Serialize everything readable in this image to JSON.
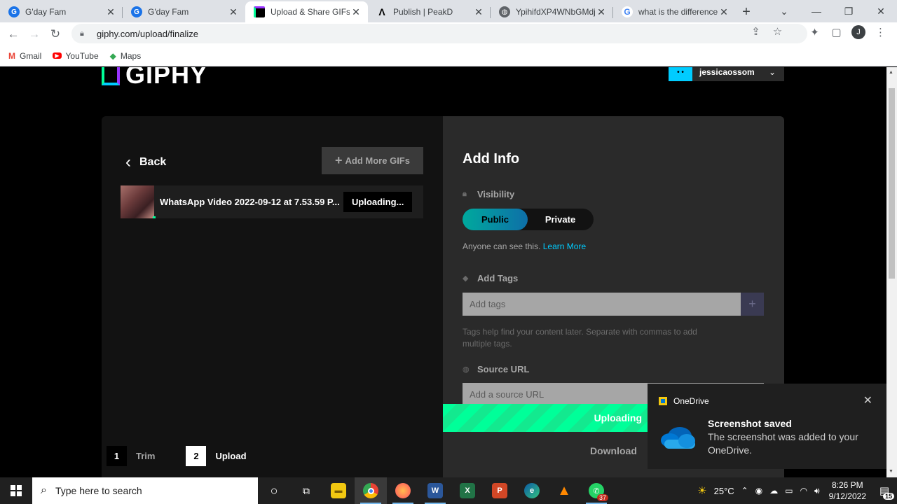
{
  "browser": {
    "tabs": [
      {
        "title": "G'day Fam",
        "favicon": "globe-icon",
        "color": "#1a73e8"
      },
      {
        "title": "G'day Fam",
        "favicon": "globe-icon",
        "color": "#1a73e8"
      },
      {
        "title": "Upload & Share GIFs",
        "favicon": "giphy-icon",
        "color": "#000000"
      },
      {
        "title": "Publish | PeakD",
        "favicon": "peakd-icon",
        "color": "#e31337"
      },
      {
        "title": "YpihifdXP4WNbGMdj",
        "favicon": "globe-icon",
        "color": "#5f6368"
      },
      {
        "title": "what is the difference",
        "favicon": "google-icon",
        "color": "#4285f4"
      }
    ],
    "new_tab_symbol": "+",
    "url": "giphy.com/upload/finalize",
    "profile_initial": "J",
    "bookmarks": [
      {
        "label": "Gmail",
        "icon": "gmail-icon"
      },
      {
        "label": "YouTube",
        "icon": "youtube-icon"
      },
      {
        "label": "Maps",
        "icon": "maps-icon"
      }
    ]
  },
  "giphy": {
    "logo_text": "GIPHY",
    "username": "jessicaossom",
    "back_label": "Back",
    "add_more_label": "Add More GIFs",
    "file": {
      "name": "WhatsApp Video 2022-09-12 at 7.53.59 P...",
      "status": "Uploading..."
    },
    "steps": [
      {
        "num": "1",
        "label": "Trim"
      },
      {
        "num": "2",
        "label": "Upload"
      }
    ],
    "add_info_title": "Add Info",
    "visibility": {
      "label": "Visibility",
      "options": [
        "Public",
        "Private"
      ],
      "selected": "Public",
      "help": "Anyone can see this.",
      "learn_more": "Learn More"
    },
    "tags": {
      "label": "Add Tags",
      "placeholder": "Add tags",
      "add_symbol": "+",
      "help": "Tags help find your content later. Separate with commas to add multiple tags."
    },
    "source": {
      "label": "Source URL",
      "placeholder": "Add a source URL"
    },
    "upload_button": "Uploading",
    "download_button": "Download"
  },
  "toast": {
    "app": "OneDrive",
    "title": "Screenshot saved",
    "body": "The screenshot was added to your OneDrive."
  },
  "taskbar": {
    "search_placeholder": "Type here to search",
    "whatsapp_badge": "37",
    "weather": "25°C",
    "time": "8:26 PM",
    "date": "9/12/2022",
    "notification_count": "15"
  },
  "colors": {
    "giphy_green": "#00ff99",
    "giphy_blue": "#00ccff",
    "giphy_purple": "#9933ff",
    "link_blue": "#00ccff"
  }
}
